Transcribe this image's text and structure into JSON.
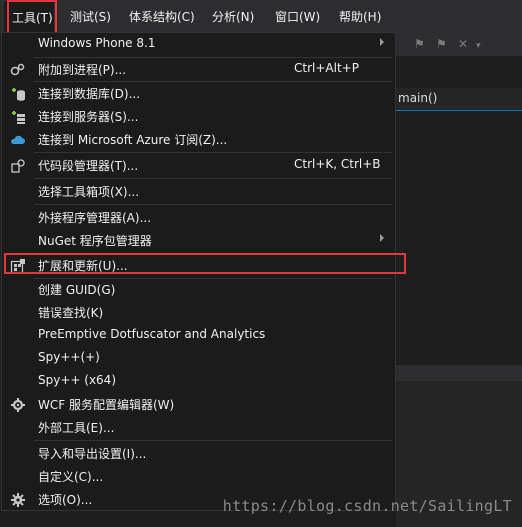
{
  "menubar": {
    "items": [
      {
        "label": "工具(T)"
      },
      {
        "label": "测试(S)"
      },
      {
        "label": "体系结构(C)"
      },
      {
        "label": "分析(N)"
      },
      {
        "label": "窗口(W)"
      },
      {
        "label": "帮助(H)"
      }
    ]
  },
  "editor": {
    "tab_text": "main()"
  },
  "tools_menu": {
    "items": [
      {
        "label": "Windows Phone 8.1",
        "shortcut": "",
        "submenu": true
      },
      {
        "label": "附加到进程(P)...",
        "shortcut": "Ctrl+Alt+P",
        "icon": "attach-process-icon"
      },
      {
        "label": "连接到数据库(D)...",
        "shortcut": "",
        "icon": "database-connect-icon"
      },
      {
        "label": "连接到服务器(S)...",
        "shortcut": "",
        "icon": "server-connect-icon"
      },
      {
        "label": "连接到 Microsoft Azure 订阅(Z)...",
        "shortcut": "",
        "icon": "azure-cloud-icon"
      },
      {
        "label": "代码段管理器(T)...",
        "shortcut": "Ctrl+K, Ctrl+B",
        "icon": "snippet-manager-icon"
      },
      {
        "label": "选择工具箱项(X)...",
        "shortcut": ""
      },
      {
        "label": "外接程序管理器(A)...",
        "shortcut": ""
      },
      {
        "label": "NuGet 程序包管理器",
        "shortcut": "",
        "submenu": true
      },
      {
        "label": "扩展和更新(U)...",
        "shortcut": "",
        "icon": "extensions-icon"
      },
      {
        "label": "创建 GUID(G)",
        "shortcut": ""
      },
      {
        "label": "错误查找(K)",
        "shortcut": ""
      },
      {
        "label": "PreEmptive Dotfuscator and Analytics",
        "shortcut": ""
      },
      {
        "label": "Spy++(+)",
        "shortcut": ""
      },
      {
        "label": "Spy++ (x64)",
        "shortcut": ""
      },
      {
        "label": "WCF 服务配置编辑器(W)",
        "shortcut": "",
        "icon": "wcf-config-icon"
      },
      {
        "label": "外部工具(E)...",
        "shortcut": ""
      },
      {
        "label": "导入和导出设置(I)...",
        "shortcut": ""
      },
      {
        "label": "自定义(C)...",
        "shortcut": ""
      },
      {
        "label": "选项(O)...",
        "shortcut": "",
        "icon": "options-gear-icon"
      }
    ]
  },
  "watermark": "https://blog.csdn.net/SailingLT",
  "colors": {
    "menu_bg": "#1b1b1c",
    "menubar_bg": "#2d2d30",
    "highlight_border": "#e2383b",
    "text": "#f1f1f1"
  }
}
